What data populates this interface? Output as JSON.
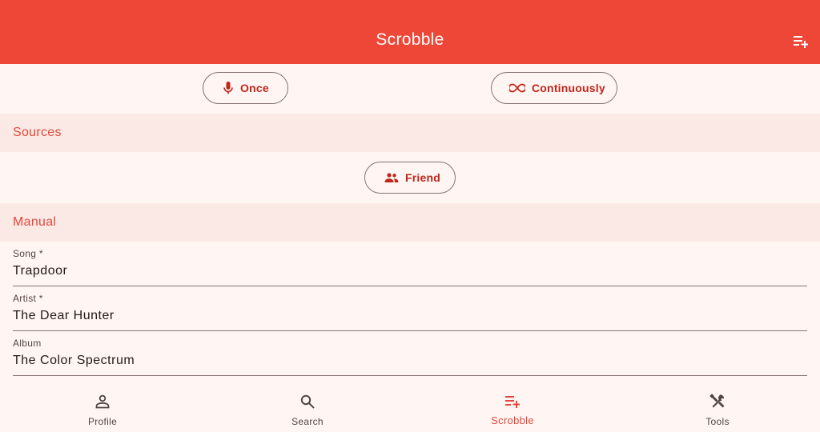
{
  "appbar": {
    "title": "Scrobble",
    "action_icon": "playlist-add-icon"
  },
  "modes": {
    "once_label": "Once",
    "once_icon": "mic-icon",
    "continuous_label": "Continuously",
    "continuous_icon": "infinity-icon"
  },
  "sources": {
    "header": "Sources",
    "friend_label": "Friend",
    "friend_icon": "people-icon"
  },
  "manual": {
    "header": "Manual",
    "fields": [
      {
        "label": "Song *",
        "value": "Trapdoor"
      },
      {
        "label": "Artist *",
        "value": "The Dear Hunter"
      },
      {
        "label": "Album",
        "value": "The Color Spectrum"
      }
    ]
  },
  "nav": {
    "items": [
      {
        "label": "Profile",
        "icon": "person-icon"
      },
      {
        "label": "Search",
        "icon": "search-icon"
      },
      {
        "label": "Scrobble",
        "icon": "playlist-add-icon"
      },
      {
        "label": "Tools",
        "icon": "tools-icon"
      }
    ],
    "active_index": 2
  },
  "colors": {
    "primary": "#ee4637",
    "accent_text": "#c0251a",
    "section_bg": "#fbe9e5",
    "background": "#fff6f4"
  }
}
